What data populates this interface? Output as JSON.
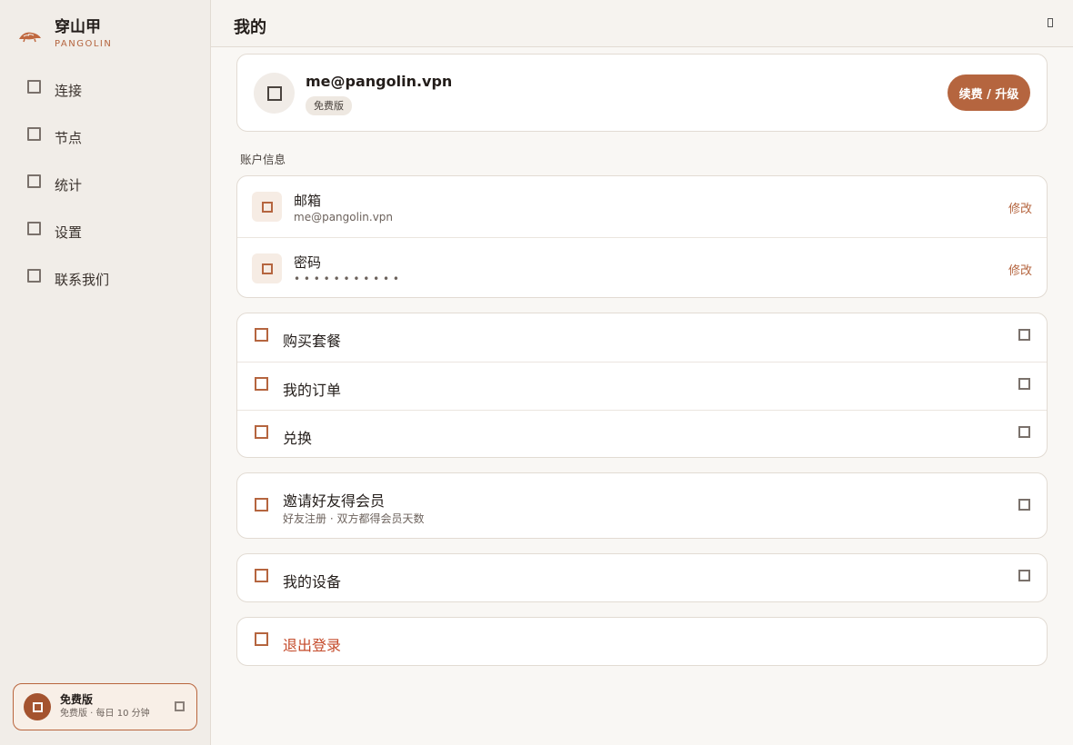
{
  "brand": {
    "name": "穿山甲",
    "subtitle": "PANGOLIN"
  },
  "nav": {
    "items": [
      {
        "label": "连接",
        "icon": "link-icon"
      },
      {
        "label": "节点",
        "icon": "server-icon"
      },
      {
        "label": "统计",
        "icon": "chart-icon"
      },
      {
        "label": "设置",
        "icon": "gear-icon"
      },
      {
        "label": "联系我们",
        "icon": "message-icon"
      }
    ]
  },
  "plan_card": {
    "title": "免费版",
    "subtitle": "免费版 · 每日 10 分钟"
  },
  "header": {
    "title": "我的"
  },
  "profile": {
    "email": "me@pangolin.vpn",
    "badge": "免费版",
    "upgrade_label": "续费 / 升级"
  },
  "account": {
    "section_label": "账户信息",
    "rows": [
      {
        "title": "邮箱",
        "value": "me@pangolin.vpn",
        "action": "修改"
      },
      {
        "title": "密码",
        "value": "• • • • • • • • • • •",
        "action": "修改"
      }
    ]
  },
  "shop": {
    "items": [
      {
        "label": "购买套餐"
      },
      {
        "label": "我的订单"
      },
      {
        "label": "兑换"
      }
    ]
  },
  "invite": {
    "label": "邀请好友得会员",
    "subtitle": "好友注册 · 双方都得会员天数"
  },
  "devices": {
    "label": "我的设备"
  },
  "logout": {
    "label": "退出登录"
  },
  "colors": {
    "accent": "#b5653f",
    "danger": "#c44a2a",
    "sidebar_bg": "#f1ede8",
    "page_bg": "#f9f7f4"
  }
}
